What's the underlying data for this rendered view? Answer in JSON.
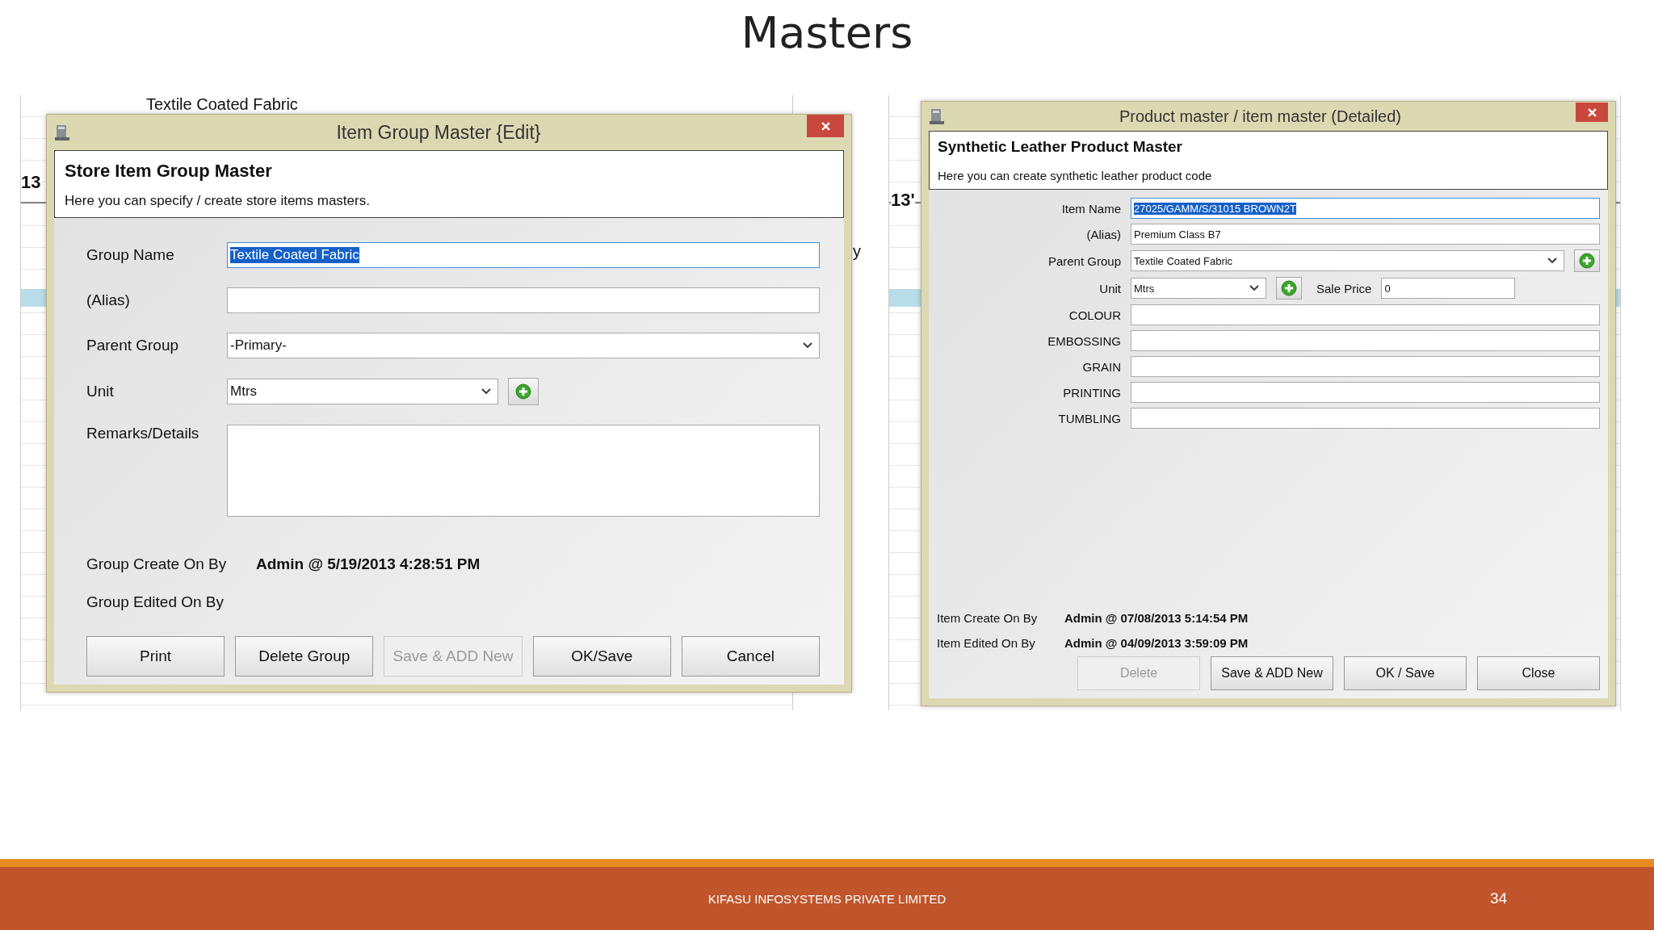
{
  "slide_title": "Masters",
  "background_left": {
    "texts": [
      "Textile Coated Fabric",
      "13",
      "y"
    ]
  },
  "background_right": {
    "texts": [
      "13'"
    ]
  },
  "item_group_dialog": {
    "title": "Item Group Master {Edit}",
    "heading": "Store Item Group Master",
    "subtitle": "Here you can specify / create store items masters.",
    "fields": [
      {
        "kind": "text",
        "label": "Group Name",
        "value": "Textile Coated Fabric",
        "highlighted": true
      },
      {
        "kind": "text",
        "label": "(Alias)"
      },
      {
        "kind": "dropdown",
        "label": "Parent Group",
        "value": "-Primary-"
      },
      {
        "kind": "dropdown_add",
        "label": "Unit",
        "value": "Mtrs"
      },
      {
        "kind": "textarea",
        "label": "Remarks/Details"
      }
    ],
    "audit": [
      {
        "label": "Group Create On By",
        "value": "Admin @ 5/19/2013 4:28:51 PM"
      },
      {
        "label": "Group Edited On By"
      }
    ],
    "buttons": [
      {
        "label": "Print",
        "disabled": false
      },
      {
        "label": "Delete Group",
        "disabled": false
      },
      {
        "label": "Save & ADD New",
        "disabled": true
      },
      {
        "label": "OK/Save",
        "disabled": false
      },
      {
        "label": "Cancel",
        "disabled": false
      }
    ]
  },
  "product_dialog": {
    "title": "Product master / item master (Detailed)",
    "heading": "Synthetic Leather Product Master",
    "subtitle": "Here you can create synthetic leather product code",
    "fields": [
      {
        "kind": "text",
        "label": "Item Name",
        "value": "27025/GAMM/S/31015 BROWN2T",
        "highlighted": true
      },
      {
        "kind": "text",
        "label": "(Alias)",
        "value": "Premium Class B7",
        "highlighted": false
      },
      {
        "kind": "dropdown_add",
        "label": "Parent Group",
        "value": "Textile Coated Fabric"
      },
      {
        "kind": "unit_price",
        "label": "Unit",
        "value": "Mtrs",
        "price_label": "Sale Price",
        "price_value": "0"
      },
      {
        "kind": "text",
        "label": "COLOUR"
      },
      {
        "kind": "text",
        "label": "EMBOSSING"
      },
      {
        "kind": "text",
        "label": "GRAIN"
      },
      {
        "kind": "text",
        "label": "PRINTING"
      },
      {
        "kind": "text",
        "label": "TUMBLING"
      }
    ],
    "audit": [
      {
        "label": "Item Create On By",
        "value": "Admin @ 07/08/2013 5:14:54 PM"
      },
      {
        "label": "Item Edited On By",
        "value": "Admin @ 04/09/2013 3:59:09 PM"
      }
    ],
    "buttons": [
      {
        "label": "Delete",
        "disabled": true
      },
      {
        "label": "Save & ADD New",
        "disabled": false
      },
      {
        "label": "OK / Save",
        "disabled": false
      },
      {
        "label": "Close",
        "disabled": false
      }
    ]
  },
  "footer": {
    "company": "KIFASU INFOSYSTEMS PRIVATE LIMITED",
    "page": "34"
  }
}
